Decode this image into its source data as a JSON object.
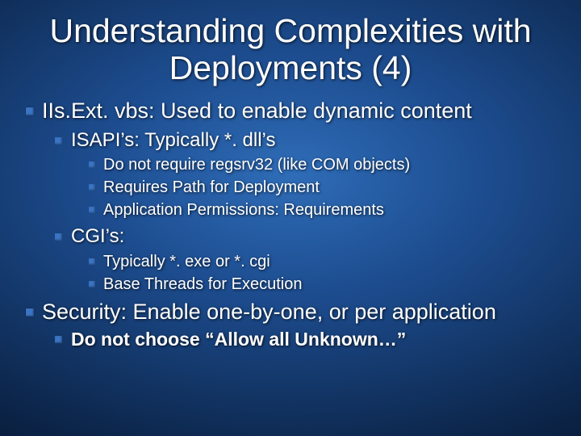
{
  "title": "Understanding Complexities with Deployments (4)",
  "bullets": {
    "b1": "IIs.Ext. vbs:  Used to enable dynamic content",
    "b1_1": "ISAPI’s:  Typically *. dll’s",
    "b1_1_1": "Do not require regsrv32 (like COM objects)",
    "b1_1_2": "Requires Path for Deployment",
    "b1_1_3": "Application Permissions:  Requirements",
    "b1_2": "CGI’s:",
    "b1_2_1": "Typically *. exe or *. cgi",
    "b1_2_2": "Base Threads for Execution",
    "b2": "Security:  Enable one-by-one, or per application",
    "b2_1": "Do not choose “Allow all Unknown…”"
  }
}
